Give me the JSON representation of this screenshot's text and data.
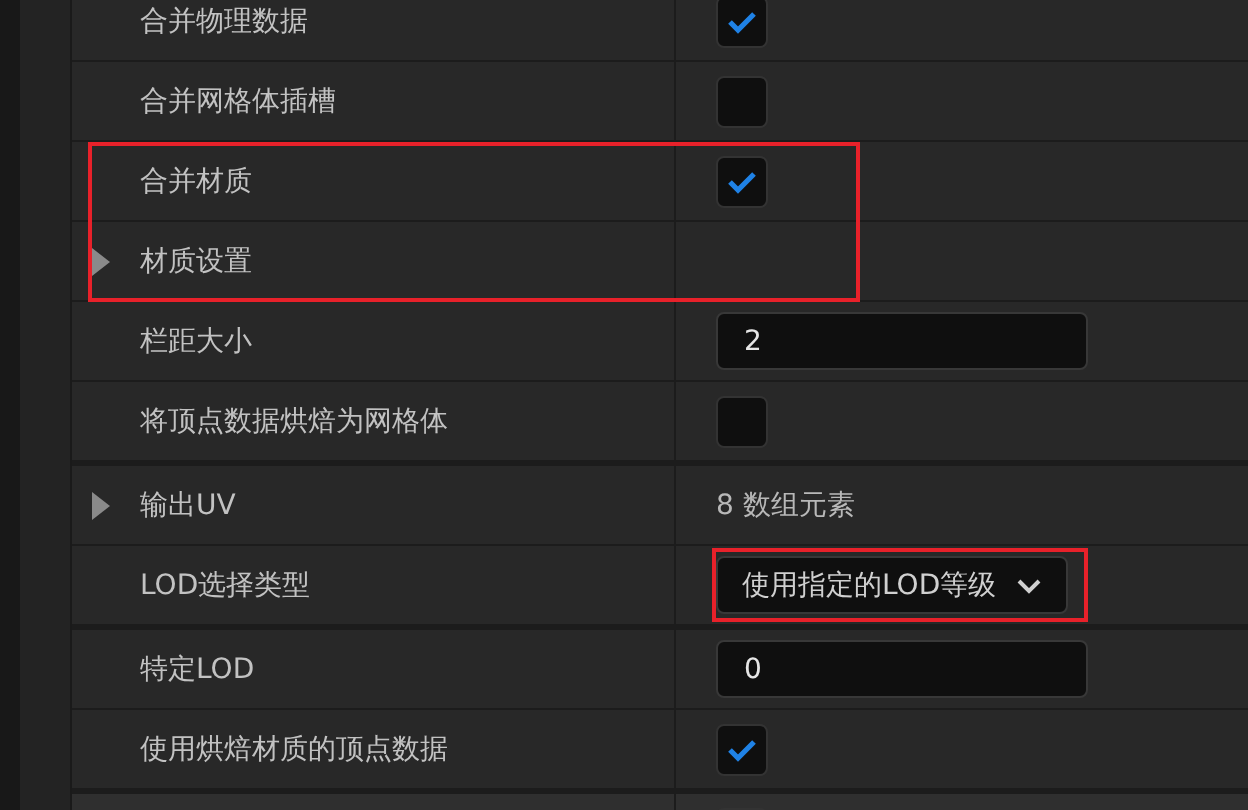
{
  "rows": [
    {
      "label": "合并物理数据",
      "kind": "checkbox",
      "checked": true,
      "highlighted": false
    },
    {
      "label": "合并网格体插槽",
      "kind": "checkbox",
      "checked": false,
      "highlighted": false
    },
    {
      "label": "合并材质",
      "kind": "checkbox",
      "checked": true,
      "highlighted": true
    },
    {
      "label": "材质设置",
      "kind": "group",
      "expanded": false,
      "highlighted": true
    },
    {
      "label": "栏距大小",
      "kind": "number",
      "value": "2",
      "highlighted": false
    },
    {
      "label": "将顶点数据烘焙为网格体",
      "kind": "checkbox",
      "checked": false,
      "highlighted": false,
      "section_end": true
    },
    {
      "label": "输出UV",
      "kind": "array",
      "expanded": false,
      "value": "8 数组元素",
      "highlighted": false
    },
    {
      "label": "LOD选择类型",
      "kind": "dropdown",
      "value": "使用指定的LOD等级",
      "value_highlighted": true,
      "highlighted": false,
      "section_end": true
    },
    {
      "label": "特定LOD",
      "kind": "number",
      "value": "0",
      "highlighted": false
    },
    {
      "label": "使用烘焙材质的顶点数据",
      "kind": "checkbox",
      "checked": true,
      "highlighted": false,
      "section_end": true
    },
    {
      "kind": "cut_off",
      "highlighted": false
    }
  ]
}
